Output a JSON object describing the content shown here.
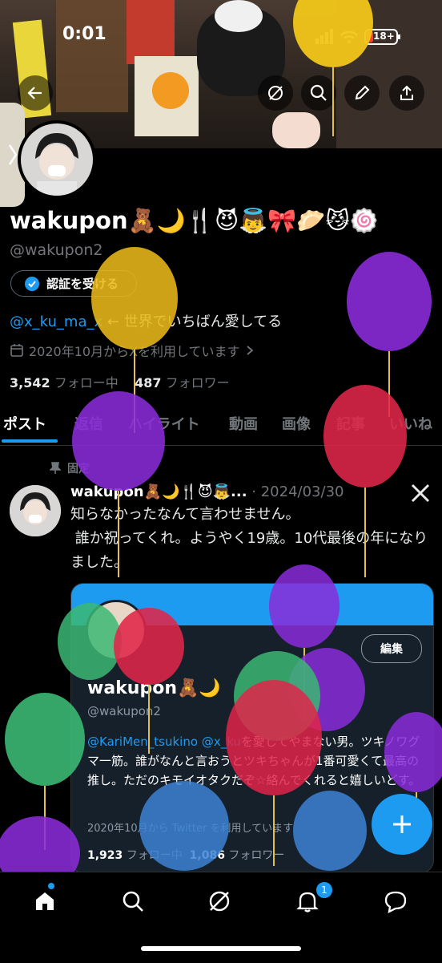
{
  "status_bar": {
    "time": "0:01",
    "battery": "18+"
  },
  "profile": {
    "display_name": "wakupon🧸🌙🍴😈👼🎀🥟😼🍥",
    "handle": "@wakupon2",
    "verify_button": "認証を受ける",
    "bio_mention": "@x_ku_ma_x",
    "bio_text": " ← 世界でいちばん愛してる",
    "joined": "2020年10月からXを利用しています",
    "following_count": "3,542",
    "following_label": "フォロー中",
    "followers_count": "487",
    "followers_label": "フォロワー"
  },
  "tabs": [
    "ポスト",
    "返信",
    "ハイライト",
    "動画",
    "画像",
    "記事",
    "いいね"
  ],
  "pinned_label": "固定",
  "tweet": {
    "name": "wakupon🧸🌙🍴😈👼...",
    "separator": " · ",
    "date": "2024/03/30",
    "text": "知らなかったなんて言わせません。\n 誰か祝ってくれ。ようやく19歳。10代最後の年になりました。"
  },
  "embed": {
    "edit_button": "編集",
    "name": "wakupon🧸🌙",
    "handle": "@wakupon2",
    "bio_mention1": "@KariMen_tsukino",
    "bio_mention2": "@x_ku",
    "bio_text": "を愛してやまない男。ツキノワグマ一筋。誰がなんと言おうとツキちゃんが1番可愛くて最高の推し。ただのキモイオタクだぞ☆絡んでくれると嬉しいどす。",
    "joined": "2020年10月から Twitter を利用しています",
    "following_count": "1,923",
    "following_label": "フォロー中",
    "followers_count": "1,086",
    "followers_label": "フォロワー"
  },
  "nav": {
    "notification_count": "1"
  },
  "colors": {
    "accent": "#1d9bf0",
    "background": "#000000",
    "muted": "#71767b"
  },
  "balloon_colors": [
    "yellow",
    "purple",
    "red",
    "green",
    "blue"
  ]
}
